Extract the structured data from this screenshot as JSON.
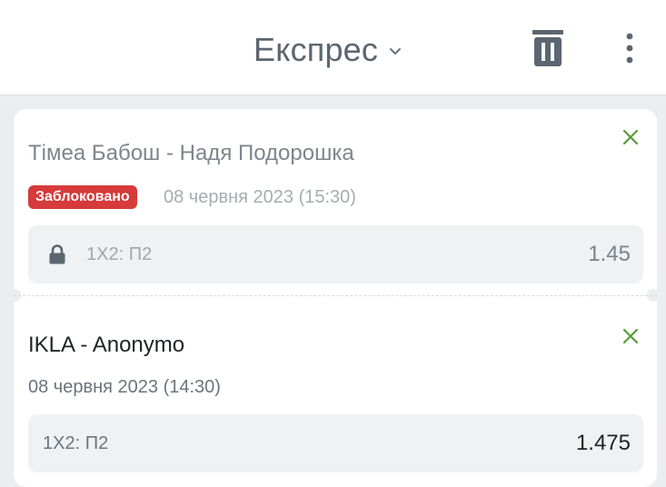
{
  "header": {
    "title": "Експрес"
  },
  "bets": [
    {
      "event": "Тімеа Бабош - Надя Подорошка",
      "status": "Заблоковано",
      "date": "08 червня 2023 (15:30)",
      "market": "1X2: П2",
      "odd": "1.45"
    },
    {
      "event": "IKLA - Anonymo",
      "date": "08 червня 2023 (14:30)",
      "market": "1X2: П2",
      "odd": "1.475"
    }
  ],
  "colors": {
    "accent_green": "#5a9a3a",
    "blocked_red": "#d63a3a",
    "icon_gray": "#5b6670"
  },
  "icons": [
    "chevron-down-icon",
    "trash-icon",
    "more-vertical-icon",
    "close-icon",
    "lock-icon"
  ]
}
